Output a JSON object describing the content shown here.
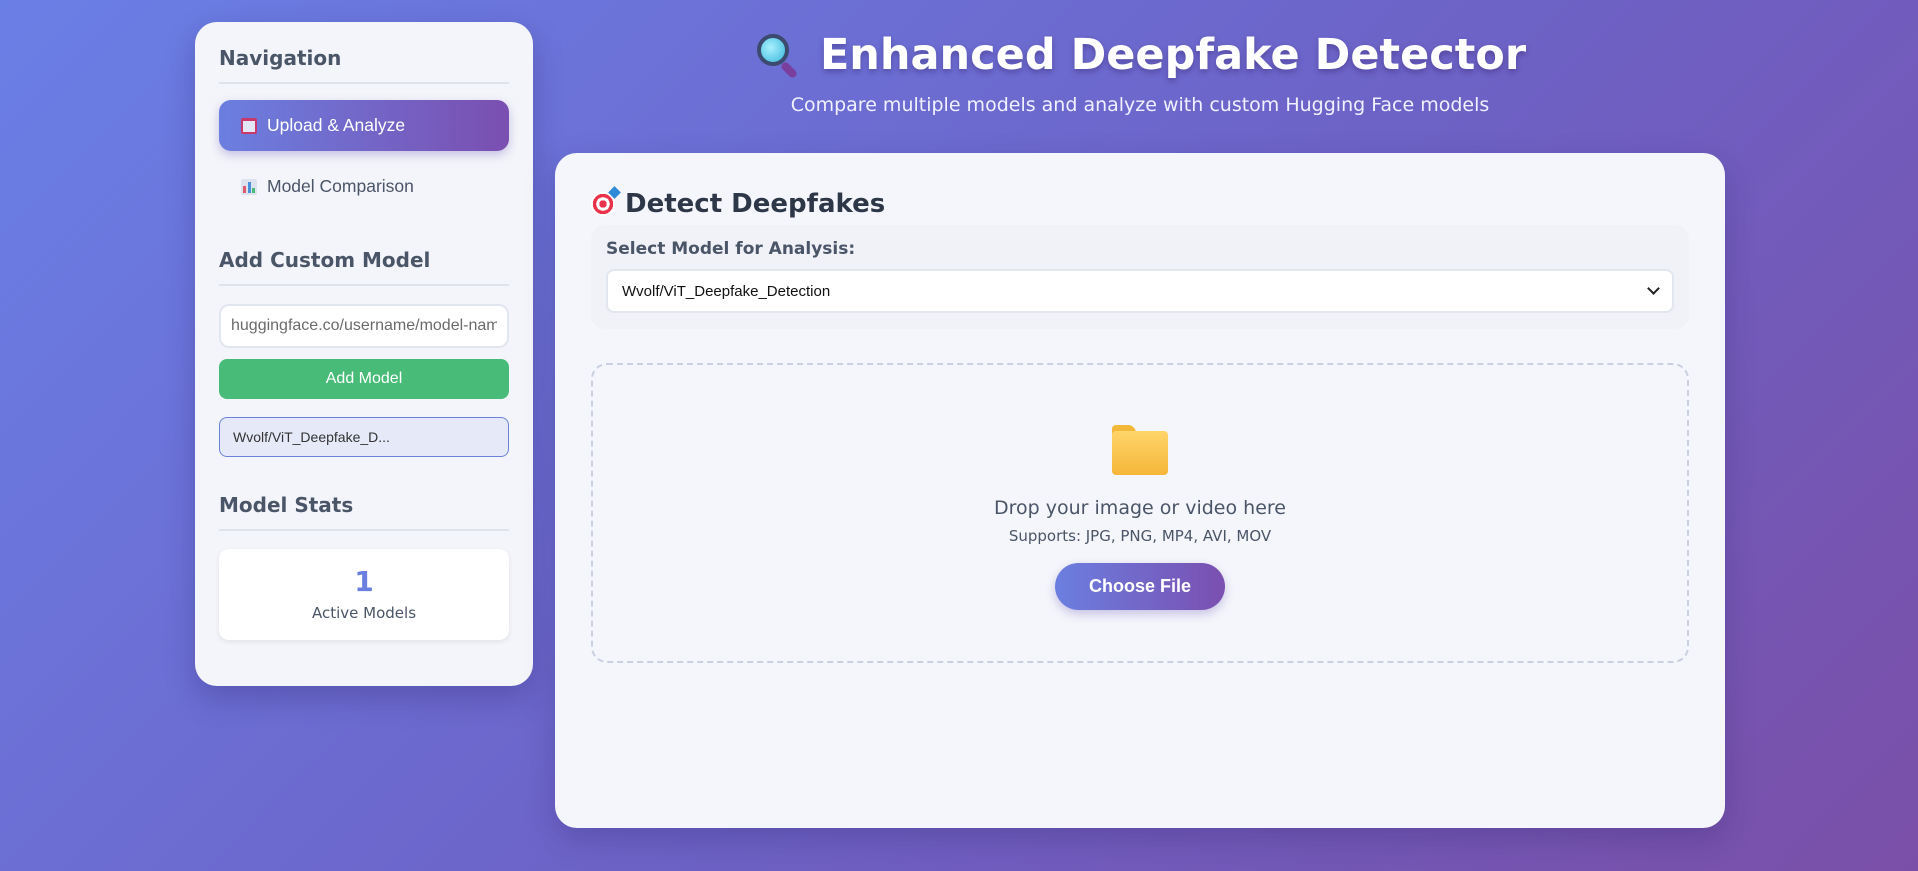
{
  "sidebar": {
    "nav_heading": "Navigation",
    "nav_items": [
      {
        "label": "Upload & Analyze",
        "icon": "inbox-tray-icon",
        "active": true
      },
      {
        "label": "Model Comparison",
        "icon": "bar-chart-icon",
        "active": false
      }
    ],
    "custom_heading": "Add Custom Model",
    "model_input_placeholder": "huggingface.co/username/model-name",
    "add_button_label": "Add Model",
    "models": [
      "Wvolf/ViT_Deepfake_D..."
    ],
    "stats_heading": "Model Stats",
    "active_models_count": "1",
    "active_models_label": "Active Models"
  },
  "header": {
    "title_icon": "magnifying-glass-icon",
    "title": "Enhanced Deepfake Detector",
    "subtitle": "Compare multiple models and analyze with custom Hugging Face models"
  },
  "main": {
    "title_icon": "target-icon",
    "title": "Detect Deepfakes",
    "select_label": "Select Model for Analysis:",
    "selected_model": "Wvolf/ViT_Deepfake_Detection",
    "dropzone": {
      "icon": "folder-icon",
      "text": "Drop your image or video here",
      "supports": "Supports: JPG, PNG, MP4, AVI, MOV",
      "button_label": "Choose File"
    }
  },
  "colors": {
    "accent_start": "#6b7fe0",
    "accent_end": "#7a4fb0",
    "add_button": "#48bb78"
  }
}
